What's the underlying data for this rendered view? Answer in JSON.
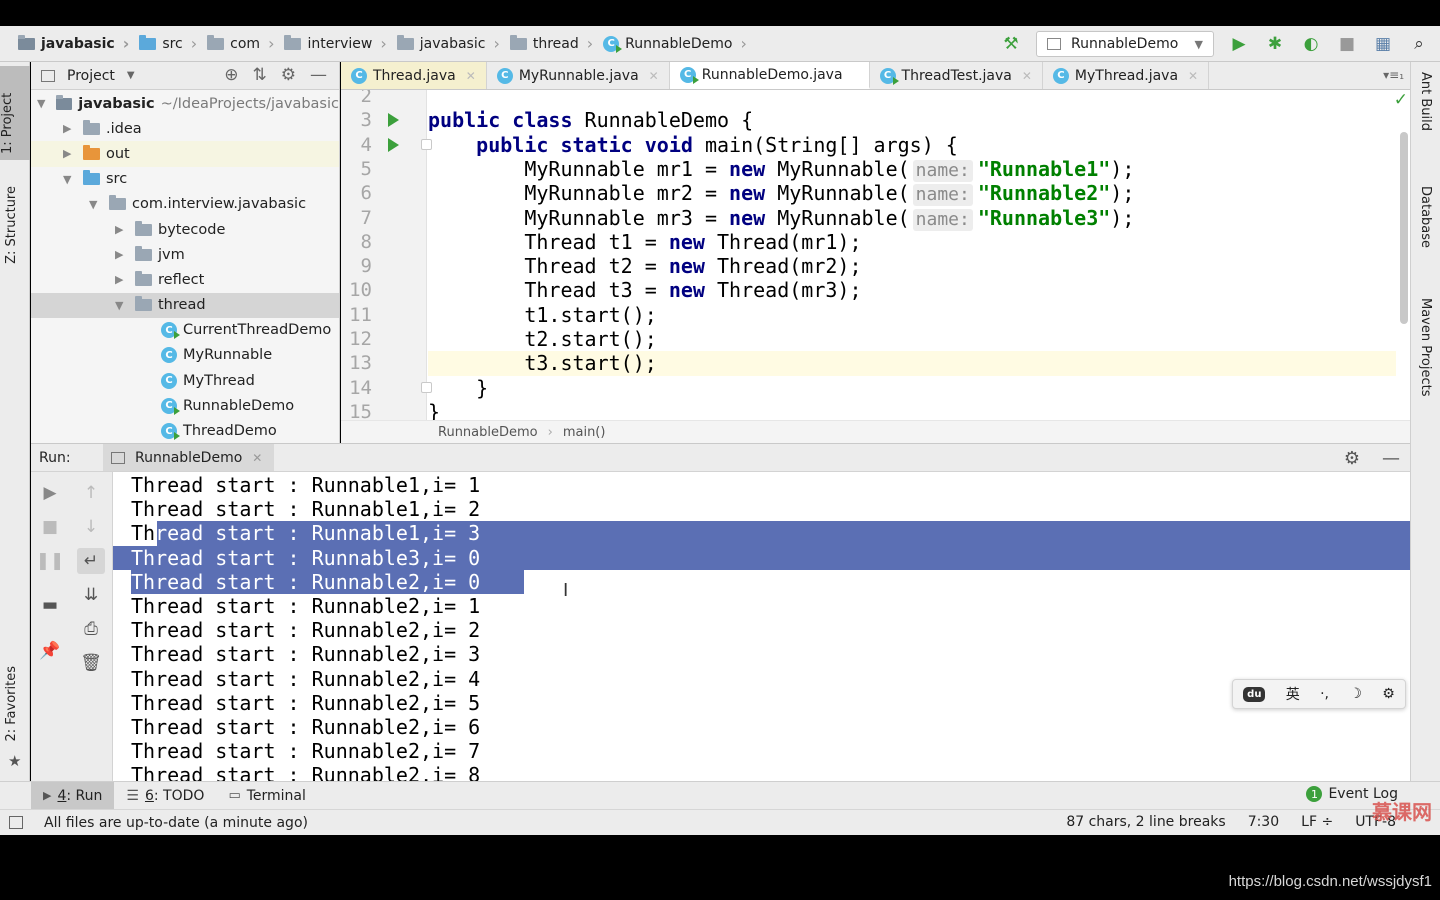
{
  "nav": {
    "breadcrumbs": [
      "javabasic",
      "src",
      "com",
      "interview",
      "javabasic",
      "thread",
      "RunnableDemo"
    ],
    "run_config": "RunnableDemo"
  },
  "left_strip": {
    "project_tab": "1: Project",
    "structure_tab": "Z: Structure",
    "favorites_tab": "2: Favorites"
  },
  "right_strip": {
    "ant": "Ant Build",
    "database": "Database",
    "maven": "Maven Projects"
  },
  "project": {
    "header": "Project",
    "tree": [
      {
        "label": "javabasic",
        "extra": "~/IdeaProjects/javabasic",
        "depth": 0,
        "icon": "project-folder-icon",
        "arrow": "▼"
      },
      {
        "label": ".idea",
        "depth": 1,
        "icon": "folder-icon",
        "arrow": "▶"
      },
      {
        "label": "out",
        "depth": 1,
        "icon": "folder-orange-icon",
        "arrow": "▶"
      },
      {
        "label": "src",
        "depth": 1,
        "icon": "folder-blue-icon",
        "arrow": "▼"
      },
      {
        "label": "com.interview.javabasic",
        "depth": 2,
        "icon": "package-icon",
        "arrow": "▼"
      },
      {
        "label": "bytecode",
        "depth": 3,
        "icon": "package-icon",
        "arrow": "▶"
      },
      {
        "label": "jvm",
        "depth": 3,
        "icon": "package-icon",
        "arrow": "▶"
      },
      {
        "label": "reflect",
        "depth": 3,
        "icon": "package-icon",
        "arrow": "▶"
      },
      {
        "label": "thread",
        "depth": 3,
        "icon": "package-icon",
        "arrow": "▼"
      },
      {
        "label": "CurrentThreadDemo",
        "depth": 4,
        "icon": "class-run-icon",
        "arrow": ""
      },
      {
        "label": "MyRunnable",
        "depth": 4,
        "icon": "class-icon",
        "arrow": ""
      },
      {
        "label": "MyThread",
        "depth": 4,
        "icon": "class-icon",
        "arrow": ""
      },
      {
        "label": "RunnableDemo",
        "depth": 4,
        "icon": "class-run-icon",
        "arrow": ""
      },
      {
        "label": "ThreadDemo",
        "depth": 4,
        "icon": "class-run-icon",
        "arrow": ""
      }
    ]
  },
  "editor": {
    "tabs": [
      {
        "label": "Thread.java",
        "icon": "class-icon"
      },
      {
        "label": "MyRunnable.java",
        "icon": "class-icon"
      },
      {
        "label": "RunnableDemo.java",
        "icon": "class-run-icon"
      },
      {
        "label": "ThreadTest.java",
        "icon": "class-run-icon"
      },
      {
        "label": "MyThread.java",
        "icon": "class-icon"
      }
    ],
    "active_tab": "RunnableDemo.java",
    "lines": [
      {
        "n": "2",
        "html": ""
      },
      {
        "n": "3",
        "run": true,
        "html": "<span class=\"kw\">public class</span> RunnableDemo {"
      },
      {
        "n": "4",
        "run": true,
        "fold": true,
        "html": "    <span class=\"kw\">public static void</span> main(String[] args) {"
      },
      {
        "n": "5",
        "html": "        MyRunnable mr1 = <span class=\"kw\">new</span> MyRunnable(<span class=\"hint\">name:</span><span class=\"str\">\"Runnable1\"</span>);"
      },
      {
        "n": "6",
        "html": "        MyRunnable mr2 = <span class=\"kw\">new</span> MyRunnable(<span class=\"hint\">name:</span><span class=\"str\">\"Runnable2\"</span>);"
      },
      {
        "n": "7",
        "html": "        MyRunnable mr3 = <span class=\"kw\">new</span> MyRunnable(<span class=\"hint\">name:</span><span class=\"str\">\"Runnable3\"</span>);"
      },
      {
        "n": "8",
        "html": "        Thread t1 = <span class=\"kw\">new</span> Thread(mr1);"
      },
      {
        "n": "9",
        "html": "        Thread t2 = <span class=\"kw\">new</span> Thread(mr2);"
      },
      {
        "n": "10",
        "html": "        Thread t3 = <span class=\"kw\">new</span> Thread(mr3);"
      },
      {
        "n": "11",
        "html": "        t1.start();"
      },
      {
        "n": "12",
        "html": "        t2.start();"
      },
      {
        "n": "13",
        "current": true,
        "html": "        t3.start();"
      },
      {
        "n": "14",
        "fold": true,
        "html": "    }"
      },
      {
        "n": "15",
        "html": "}"
      }
    ],
    "breadcrumb": [
      "RunnableDemo",
      "main()"
    ]
  },
  "run": {
    "label": "Run:",
    "tab": "RunnableDemo",
    "output": [
      {
        "text": "Thread start : Runnable1,i= 1"
      },
      {
        "text": "Thread start : Runnable1,i= 2"
      },
      {
        "text": "Thread start : Runnable1,i= 3",
        "sel": "full-from-third"
      },
      {
        "text": "Thread start : Runnable3,i= 0",
        "sel": "full"
      },
      {
        "text": "Thread start : Runnable2,i= 0",
        "sel": "to-end"
      },
      {
        "text": "Thread start : Runnable2,i= 1"
      },
      {
        "text": "Thread start : Runnable2,i= 2"
      },
      {
        "text": "Thread start : Runnable2,i= 3"
      },
      {
        "text": "Thread start : Runnable2,i= 4"
      },
      {
        "text": "Thread start : Runnable2,i= 5"
      },
      {
        "text": "Thread start : Runnable2,i= 6"
      },
      {
        "text": "Thread start : Runnable2,i= 7"
      },
      {
        "text": "Thread start : Runnable2,i= 8"
      }
    ]
  },
  "ime": {
    "lang": "英",
    "punct": "·,",
    "moon": "☽",
    "gear": "⚙"
  },
  "bottom_tools": {
    "run_num": "4",
    "run_label": ": Run",
    "todo_num": "6",
    "todo_label": ": TODO",
    "terminal": "Terminal",
    "event_count": "1",
    "event_log": "Event Log"
  },
  "status": {
    "message": "All files are up-to-date (a minute ago)",
    "selection": "87 chars, 2 line breaks",
    "position": "7:30",
    "line_sep": "LF",
    "encoding": "UTF-8"
  },
  "watermark": "https://blog.csdn.net/wssjdysf1",
  "brand": "慕课网",
  "colors": {
    "selection": "#5b6fb4",
    "keyword": "#000080",
    "string": "#008000",
    "run_green": "#3ca03c"
  }
}
